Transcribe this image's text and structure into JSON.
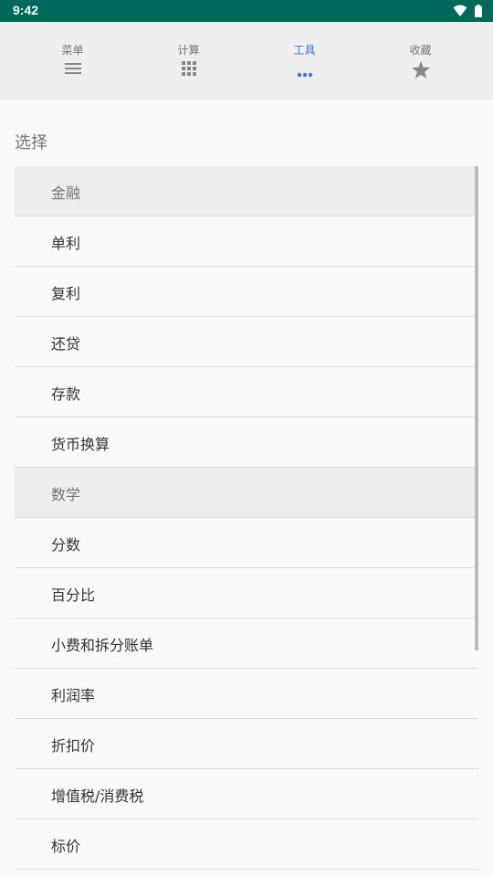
{
  "status_bar": {
    "time": "9:42"
  },
  "tabs": [
    {
      "label": "菜单",
      "icon": "menu-icon",
      "active": false
    },
    {
      "label": "计算",
      "icon": "grid-icon",
      "active": false
    },
    {
      "label": "工具",
      "icon": "more-dots-icon",
      "active": true
    },
    {
      "label": "收藏",
      "icon": "star-icon",
      "active": false
    }
  ],
  "heading": "选择",
  "list": [
    {
      "label": "金融",
      "type": "category"
    },
    {
      "label": "单利",
      "type": "item"
    },
    {
      "label": "复利",
      "type": "item"
    },
    {
      "label": "还贷",
      "type": "item"
    },
    {
      "label": "存款",
      "type": "item"
    },
    {
      "label": "货币换算",
      "type": "item"
    },
    {
      "label": "数学",
      "type": "category"
    },
    {
      "label": "分数",
      "type": "item"
    },
    {
      "label": "百分比",
      "type": "item"
    },
    {
      "label": "小费和拆分账单",
      "type": "item"
    },
    {
      "label": "利润率",
      "type": "item"
    },
    {
      "label": "折扣价",
      "type": "item"
    },
    {
      "label": "增值税/消费税",
      "type": "item"
    },
    {
      "label": "标价",
      "type": "item"
    }
  ],
  "colors": {
    "status_bar": "#00695c",
    "accent": "#3c78d8",
    "tab_bar": "#eeeeee",
    "category_bg": "#eeeeee"
  }
}
